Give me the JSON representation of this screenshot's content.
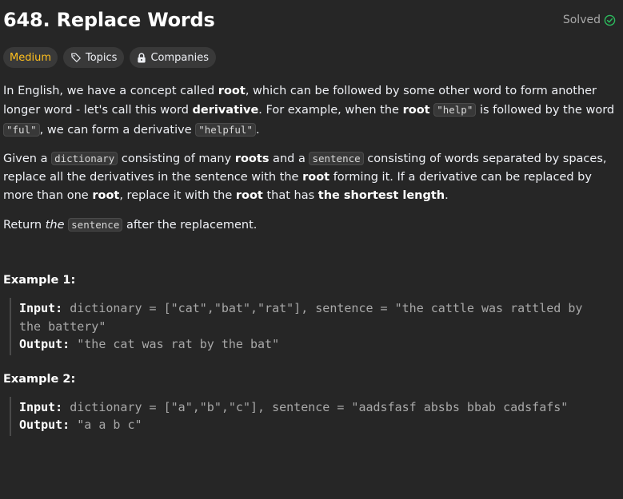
{
  "problem": {
    "title": "648. Replace Words",
    "status": "Solved"
  },
  "tags": {
    "difficulty": "Medium",
    "topics": "Topics",
    "companies": "Companies"
  },
  "description": {
    "p1": {
      "t1": "In English, we have a concept called ",
      "b1": "root",
      "t2": ", which can be followed by some other word to form another longer word - let's call this word ",
      "b2": "derivative",
      "t3": ". For example, when the ",
      "b3": "root",
      "t4": " ",
      "c1": "\"help\"",
      "t5": " is followed by the word ",
      "c2": "\"ful\"",
      "t6": ", we can form a derivative ",
      "c3": "\"helpful\"",
      "t7": "."
    },
    "p2": {
      "t1": "Given a ",
      "c1": "dictionary",
      "t2": " consisting of many ",
      "b1": "roots",
      "t3": " and a ",
      "c2": "sentence",
      "t4": " consisting of words separated by spaces, replace all the derivatives in the sentence with the ",
      "b2": "root",
      "t5": " forming it. If a derivative can be replaced by more than one ",
      "b3": "root",
      "t6": ", replace it with the ",
      "b4": "root",
      "t7": " that has ",
      "b5": "the shortest length",
      "t8": "."
    },
    "p3": {
      "t1": "Return ",
      "i1": "the",
      "t2": " ",
      "c1": "sentence",
      "t3": " after the replacement."
    }
  },
  "examples": [
    {
      "title": "Example 1:",
      "input_label": "Input:",
      "input": " dictionary = [\"cat\",\"bat\",\"rat\"], sentence = \"the cattle was rattled by the battery\"",
      "output_label": "Output:",
      "output": " \"the cat was rat by the bat\""
    },
    {
      "title": "Example 2:",
      "input_label": "Input:",
      "input": " dictionary = [\"a\",\"b\",\"c\"], sentence = \"aadsfasf absbs bbab cadsfafs\"",
      "output_label": "Output:",
      "output": " \"a a b c\""
    }
  ],
  "colors": {
    "background": "#262626",
    "difficulty": "#ffc01e",
    "solved_check": "#2cbb5d"
  },
  "icons": {
    "solved": "check-circle-icon",
    "topics": "tag-icon",
    "companies": "lock-icon"
  }
}
